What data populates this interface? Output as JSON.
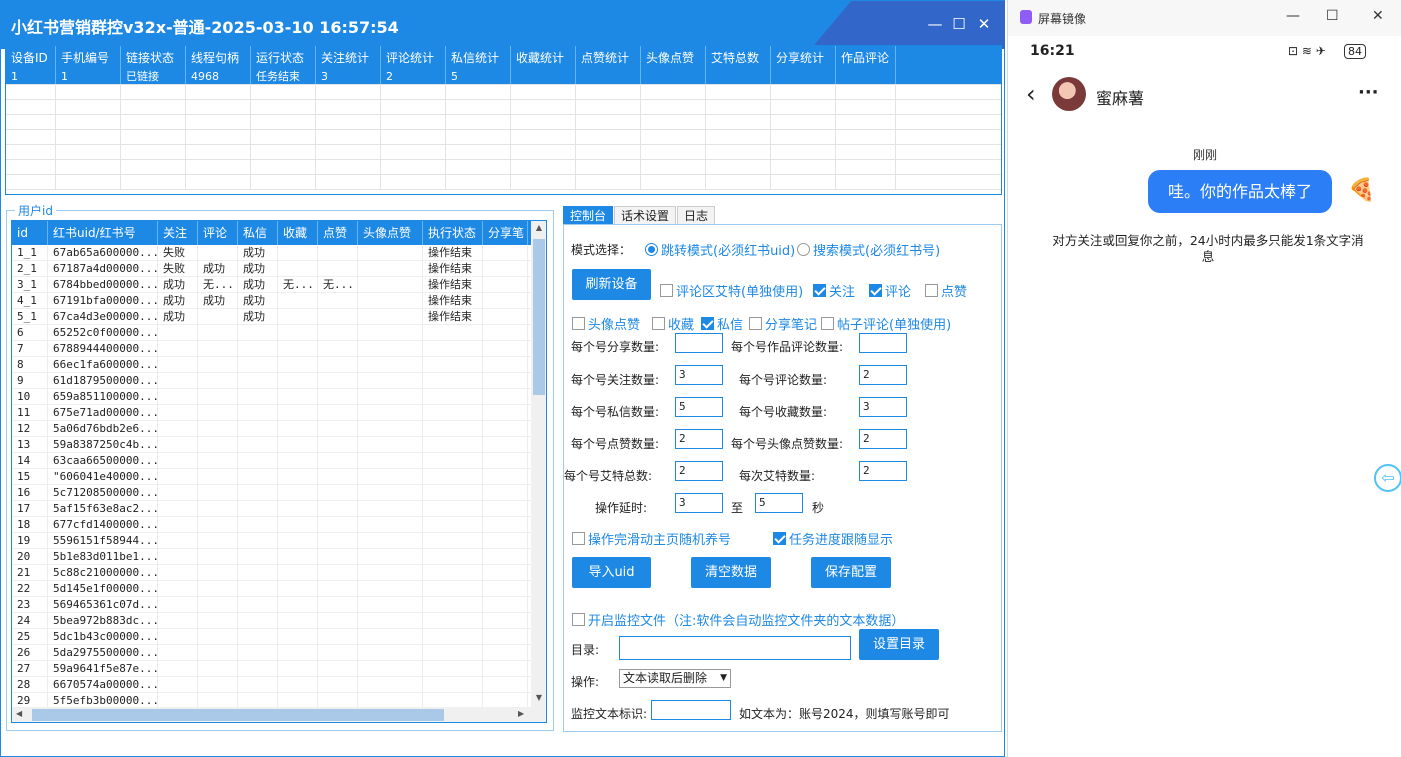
{
  "window": {
    "title": "小红书营销群控v32x-普通-2025-03-10 16:57:54",
    "minimize": "—",
    "maximize": "☐",
    "close": "✕"
  },
  "device_grid": {
    "headers": [
      "设备ID",
      "手机编号",
      "链接状态",
      "线程句柄",
      "运行状态",
      "关注统计",
      "评论统计",
      "私信统计",
      "收藏统计",
      "点赞统计",
      "头像点赞",
      "艾特总数",
      "分享统计",
      "作品评论"
    ],
    "rows": [
      [
        "1",
        "1",
        "已链接",
        "4968",
        "任务结束",
        "3",
        "2",
        "5",
        "",
        "",
        "",
        "",
        "",
        ""
      ]
    ]
  },
  "user_group": {
    "legend": "用户id",
    "headers": [
      "id",
      "红书uid/红书号",
      "关注",
      "评论",
      "私信",
      "收藏",
      "点赞",
      "头像点赞",
      "执行状态",
      "分享笔"
    ],
    "rows": [
      [
        "1_1",
        "67ab65a600000...",
        "失败",
        "",
        "成功",
        "",
        "",
        "",
        "操作结束",
        ""
      ],
      [
        "2_1",
        "67187a4d00000...",
        "失败",
        "成功",
        "成功",
        "",
        "",
        "",
        "操作结束",
        ""
      ],
      [
        "3_1",
        "6784bbed00000...",
        "成功",
        "无...",
        "成功",
        "无...",
        "无...",
        "",
        "操作结束",
        ""
      ],
      [
        "4_1",
        "67191bfa00000...",
        "成功",
        "成功",
        "成功",
        "",
        "",
        "",
        "操作结束",
        ""
      ],
      [
        "5_1",
        "67ca4d3e00000...",
        "成功",
        "",
        "成功",
        "",
        "",
        "",
        "操作结束",
        ""
      ],
      [
        "6",
        "65252c0f00000...",
        "",
        "",
        "",
        "",
        "",
        "",
        "",
        ""
      ],
      [
        "7",
        "6788944400000...",
        "",
        "",
        "",
        "",
        "",
        "",
        "",
        ""
      ],
      [
        "8",
        "66ec1fa600000...",
        "",
        "",
        "",
        "",
        "",
        "",
        "",
        ""
      ],
      [
        "9",
        "61d1879500000...",
        "",
        "",
        "",
        "",
        "",
        "",
        "",
        ""
      ],
      [
        "10",
        "659a851100000...",
        "",
        "",
        "",
        "",
        "",
        "",
        "",
        ""
      ],
      [
        "11",
        "675e71ad00000...",
        "",
        "",
        "",
        "",
        "",
        "",
        "",
        ""
      ],
      [
        "12",
        "5a06d76bdb2e6...",
        "",
        "",
        "",
        "",
        "",
        "",
        "",
        ""
      ],
      [
        "13",
        "59a8387250c4b...",
        "",
        "",
        "",
        "",
        "",
        "",
        "",
        ""
      ],
      [
        "14",
        "63caa66500000...",
        "",
        "",
        "",
        "",
        "",
        "",
        "",
        ""
      ],
      [
        "15",
        "\"606041e40000...",
        "",
        "",
        "",
        "",
        "",
        "",
        "",
        ""
      ],
      [
        "16",
        "5c71208500000...",
        "",
        "",
        "",
        "",
        "",
        "",
        "",
        ""
      ],
      [
        "17",
        "5af15f63e8ac2...",
        "",
        "",
        "",
        "",
        "",
        "",
        "",
        ""
      ],
      [
        "18",
        "677cfd1400000...",
        "",
        "",
        "",
        "",
        "",
        "",
        "",
        ""
      ],
      [
        "19",
        "5596151f58944...",
        "",
        "",
        "",
        "",
        "",
        "",
        "",
        ""
      ],
      [
        "20",
        "5b1e83d011be1...",
        "",
        "",
        "",
        "",
        "",
        "",
        "",
        ""
      ],
      [
        "21",
        "5c88c21000000...",
        "",
        "",
        "",
        "",
        "",
        "",
        "",
        ""
      ],
      [
        "22",
        "5d145e1f00000...",
        "",
        "",
        "",
        "",
        "",
        "",
        "",
        ""
      ],
      [
        "23",
        "569465361c07d...",
        "",
        "",
        "",
        "",
        "",
        "",
        "",
        ""
      ],
      [
        "24",
        "5bea972b883dc...",
        "",
        "",
        "",
        "",
        "",
        "",
        "",
        ""
      ],
      [
        "25",
        "5dc1b43c00000...",
        "",
        "",
        "",
        "",
        "",
        "",
        "",
        ""
      ],
      [
        "26",
        "5da2975500000...",
        "",
        "",
        "",
        "",
        "",
        "",
        "",
        ""
      ],
      [
        "27",
        "59a9641f5e87e...",
        "",
        "",
        "",
        "",
        "",
        "",
        "",
        ""
      ],
      [
        "28",
        "6670574a00000...",
        "",
        "",
        "",
        "",
        "",
        "",
        "",
        ""
      ],
      [
        "29",
        "5f5efb3b00000...",
        "",
        "",
        "",
        "",
        "",
        "",
        "",
        ""
      ]
    ]
  },
  "tabs": [
    "控制台",
    "话术设置",
    "日志"
  ],
  "console": {
    "mode_label": "模式选择：",
    "mode_jump": "跳转模式(必须红书uid)",
    "mode_search": "搜索模式(必须红书号)",
    "refresh_btn": "刷新设备",
    "chk_comment_at": "评论区艾特(单独使用)",
    "chk_follow": "关注",
    "chk_comment": "评论",
    "chk_like": "点赞",
    "chk_avatar_like": "头像点赞",
    "chk_collect": "收藏",
    "chk_dm": "私信",
    "chk_share": "分享笔记",
    "chk_post_comment": "帖子评论(单独使用)",
    "share_count_label": "每个号分享数量:",
    "share_count": "",
    "work_comment_label": "每个号作品评论数量:",
    "work_comment": "",
    "follow_count_label": "每个号关注数量:",
    "follow_count": "3",
    "comment_count_label": "每个号评论数量:",
    "comment_count": "2",
    "dm_count_label": "每个号私信数量:",
    "dm_count": "5",
    "collect_count_label": "每个号收藏数量:",
    "collect_count": "3",
    "like_count_label": "每个号点赞数量:",
    "like_count": "2",
    "avatar_like_label": "每个号头像点赞数量:",
    "avatar_like_count": "2",
    "at_total_label": "每个号艾特总数:",
    "at_total": "2",
    "at_each_label": "每次艾特数量:",
    "at_each": "2",
    "delay_label": "操作延时:",
    "delay_from": "3",
    "delay_to_label": "至",
    "delay_to": "5",
    "delay_unit": "秒",
    "chk_scroll": "操作完滑动主页随机养号",
    "chk_progress": "任务进度跟随显示",
    "import_btn": "导入uid",
    "clear_btn": "清空数据",
    "save_btn": "保存配置",
    "chk_monitor": "开启监控文件（注:软件会自动监控文件夹的文本数据）",
    "dir_label": "目录:",
    "dir_value": "",
    "set_dir_btn": "设置目录",
    "op_label": "操作:",
    "op_value": "文本读取后删除",
    "monitor_label": "监控文本标识:",
    "monitor_value": "",
    "monitor_hint": "如文本为：账号2024，则填写账号即可"
  },
  "phone": {
    "app_title": "屏幕镜像",
    "time": "16:21",
    "battery": "84",
    "contact": "蜜麻薯",
    "more": "···",
    "timestamp": "刚刚",
    "message": "哇。你的作品太棒了",
    "notice": "对方关注或回复你之前，24小时内最多只能发1条文字消息",
    "emoji": "🍕"
  }
}
